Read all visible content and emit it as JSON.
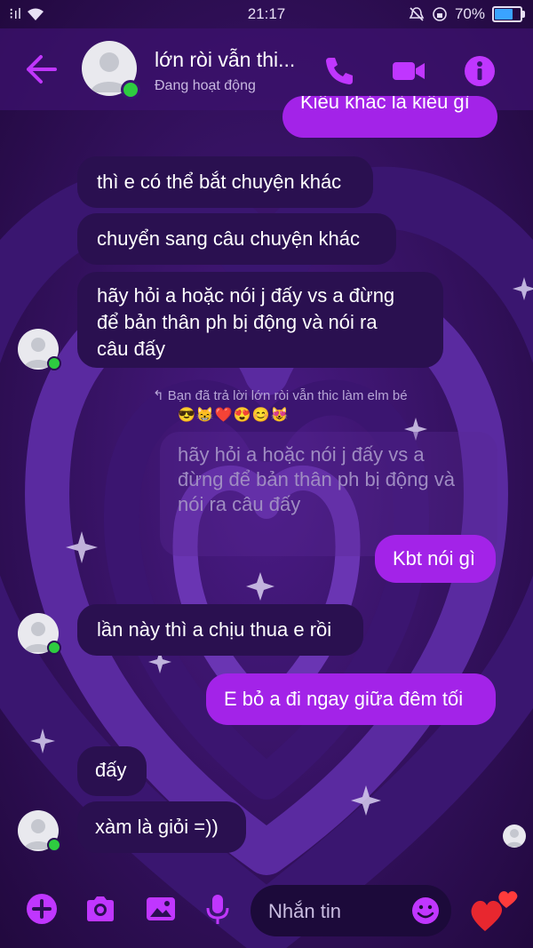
{
  "status_bar": {
    "signal": "⁝ıl",
    "time": "21:17",
    "battery": "70%",
    "battery_level": 0.7
  },
  "header": {
    "contact_name": "lớn ròi vẫn thi...",
    "contact_status": "Đang hoạt động",
    "icons": [
      "back-arrow-icon",
      "phone-icon",
      "video-camera-icon",
      "info-icon"
    ]
  },
  "messages": [
    {
      "side": "out",
      "text": "Kiểu khác là kiểu gì"
    },
    {
      "side": "in",
      "text": "thì e có thể bắt chuyện khác"
    },
    {
      "side": "in",
      "text": "chuyển sang câu chuyện khác"
    },
    {
      "side": "in",
      "text_lines": [
        "hãy hỏi a hoặc nói j đấy vs a đừng",
        "để bản thân ph bị động và nói ra",
        "câu đấy"
      ]
    },
    {
      "side": "out",
      "reply_note": "Bạn đã trả lời lớn ròi vẫn thic làm elm bé",
      "reply_emojis": "😎😸❤️😍😊😻",
      "quoted_lines": [
        "hãy hỏi a hoặc nói j đấy vs a",
        "đừng để bản thân ph bị động và",
        "nói ra câu đấy"
      ],
      "text": "Kbt nói gì"
    },
    {
      "side": "in",
      "text": "lần này thì a chịu thua e rồi"
    },
    {
      "side": "out",
      "text": "E bỏ a đi ngay giữa đêm tối"
    },
    {
      "side": "in",
      "text": "đấy"
    },
    {
      "side": "in",
      "text": "xàm là giỏi =))"
    }
  ],
  "composer": {
    "placeholder": "Nhắn tin",
    "icons": [
      "plus-icon",
      "camera-icon",
      "image-icon",
      "microphone-icon",
      "smile-icon",
      "heart-icon"
    ]
  },
  "colors": {
    "accent": "#a323e8",
    "incoming_bubble": "#2a1050",
    "background": "#2a0f52",
    "online": "#2ecc40"
  }
}
